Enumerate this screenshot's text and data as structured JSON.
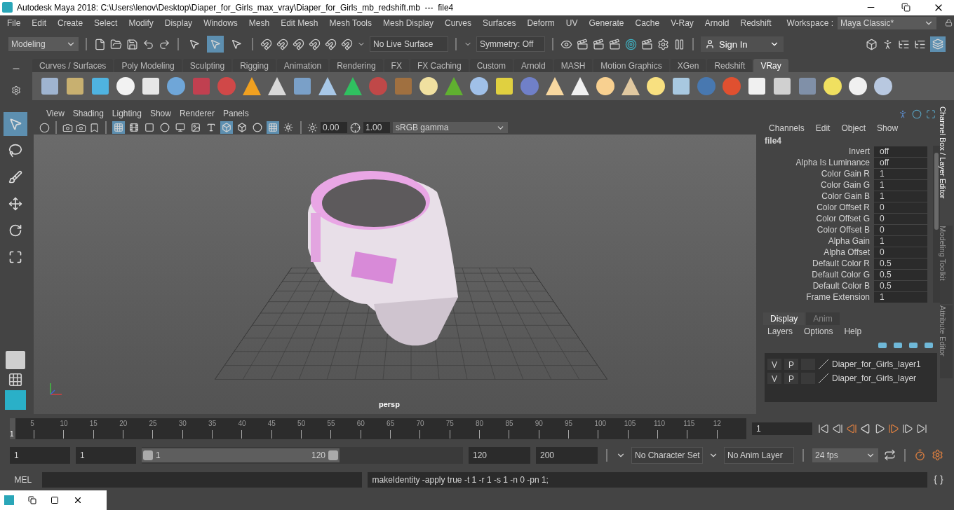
{
  "title_bar": {
    "title": "Autodesk Maya 2018: C:\\Users\\lenov\\Desktop\\Diaper_for_Girls_max_vray\\Diaper_for_Girls_mb_redshift.mb  ---  file4"
  },
  "menu_bar": [
    "File",
    "Edit",
    "Create",
    "Select",
    "Modify",
    "Display",
    "Windows",
    "Mesh",
    "Edit Mesh",
    "Mesh Tools",
    "Mesh Display",
    "Curves",
    "Surfaces",
    "Deform",
    "UV",
    "Generate",
    "Cache",
    "V-Ray",
    "Arnold",
    "Redshift"
  ],
  "workspace": {
    "label": "Workspace :",
    "value": "Maya Classic*"
  },
  "status_line": {
    "mode": "Modeling",
    "live_surface": "No Live Surface",
    "symmetry": "Symmetry: Off",
    "sign_in": "Sign In",
    "select_modes": [
      {
        "selected": false
      },
      {
        "selected": true
      },
      {
        "selected": false
      }
    ]
  },
  "shelf_tabs": [
    {
      "label": "Curves / Surfaces",
      "selected": false
    },
    {
      "label": "Poly Modeling",
      "selected": false
    },
    {
      "label": "Sculpting",
      "selected": false
    },
    {
      "label": "Rigging",
      "selected": false
    },
    {
      "label": "Animation",
      "selected": false
    },
    {
      "label": "Rendering",
      "selected": false
    },
    {
      "label": "FX",
      "selected": false
    },
    {
      "label": "FX Caching",
      "selected": false
    },
    {
      "label": "Custom",
      "selected": false
    },
    {
      "label": "Arnold",
      "selected": false
    },
    {
      "label": "MASH",
      "selected": false
    },
    {
      "label": "Motion Graphics",
      "selected": false
    },
    {
      "label": "XGen",
      "selected": false
    },
    {
      "label": "Redshift",
      "selected": false
    },
    {
      "label": "VRay",
      "selected": true
    }
  ],
  "tools": [
    {
      "selected": true
    },
    {
      "selected": false
    },
    {
      "selected": false
    },
    {
      "selected": false
    },
    {
      "selected": false
    },
    {
      "selected": false
    }
  ],
  "viewport": {
    "menu": [
      "View",
      "Shading",
      "Lighting",
      "Show",
      "Renderer",
      "Panels"
    ],
    "toolbar": [
      {
        "selected": true
      },
      {
        "selected": false
      },
      {
        "selected": false
      },
      {
        "selected": false
      },
      {
        "selected": false
      },
      {
        "selected": false
      },
      {
        "selected": false
      },
      {
        "selected": true
      },
      {
        "selected": false
      },
      {
        "selected": false
      },
      {
        "selected": true
      },
      {
        "selected": false
      }
    ],
    "exposure": "0.00",
    "gamma": "1.00",
    "color_space": "sRGB gamma",
    "camera": "persp"
  },
  "channel_box": {
    "menu": [
      "Channels",
      "Edit",
      "Object",
      "Show"
    ],
    "node": "file4",
    "attributes": [
      {
        "name": "Invert",
        "value": "off"
      },
      {
        "name": "Alpha Is Luminance",
        "value": "off"
      },
      {
        "name": "Color Gain R",
        "value": "1"
      },
      {
        "name": "Color Gain G",
        "value": "1"
      },
      {
        "name": "Color Gain B",
        "value": "1"
      },
      {
        "name": "Color Offset R",
        "value": "0"
      },
      {
        "name": "Color Offset G",
        "value": "0"
      },
      {
        "name": "Color Offset B",
        "value": "0"
      },
      {
        "name": "Alpha Gain",
        "value": "1"
      },
      {
        "name": "Alpha Offset",
        "value": "0"
      },
      {
        "name": "Default Color R",
        "value": "0.5"
      },
      {
        "name": "Default Color G",
        "value": "0.5"
      },
      {
        "name": "Default Color B",
        "value": "0.5"
      },
      {
        "name": "Frame Extension",
        "value": "1"
      }
    ]
  },
  "layer_editor": {
    "tabs": [
      {
        "label": "Display",
        "selected": true
      },
      {
        "label": "Anim",
        "selected": false
      }
    ],
    "menu": [
      "Layers",
      "Options",
      "Help"
    ],
    "layers": [
      {
        "visible": "V",
        "playback": "P",
        "name": "Diaper_for_Girls_layer1"
      },
      {
        "visible": "V",
        "playback": "P",
        "name": "Diaper_for_Girls_layer"
      }
    ]
  },
  "side_tabs": [
    {
      "label": "Channel Box / Layer Editor",
      "selected": true
    },
    {
      "label": "Modeling Toolkit",
      "selected": false
    },
    {
      "label": "Attribute Editor",
      "selected": false
    }
  ],
  "time_slider": {
    "ticks": [
      "5",
      "10",
      "15",
      "20",
      "25",
      "30",
      "35",
      "40",
      "45",
      "50",
      "55",
      "60",
      "65",
      "70",
      "75",
      "80",
      "85",
      "90",
      "95",
      "100",
      "105",
      "110",
      "115",
      "12"
    ],
    "marker": "1",
    "current_frame": "1"
  },
  "range_slider": {
    "start": "1",
    "playback_start": "1",
    "handle_start": "1",
    "handle_end": "120",
    "playback_end": "120",
    "end": "200",
    "character_set": "No Character Set",
    "anim_layer": "No Anim Layer",
    "fps": "24 fps"
  },
  "command_line": {
    "label": "MEL",
    "result": "makeIdentity -apply true -t 1 -r 1 -s 1 -n 0 -pn 1;"
  }
}
